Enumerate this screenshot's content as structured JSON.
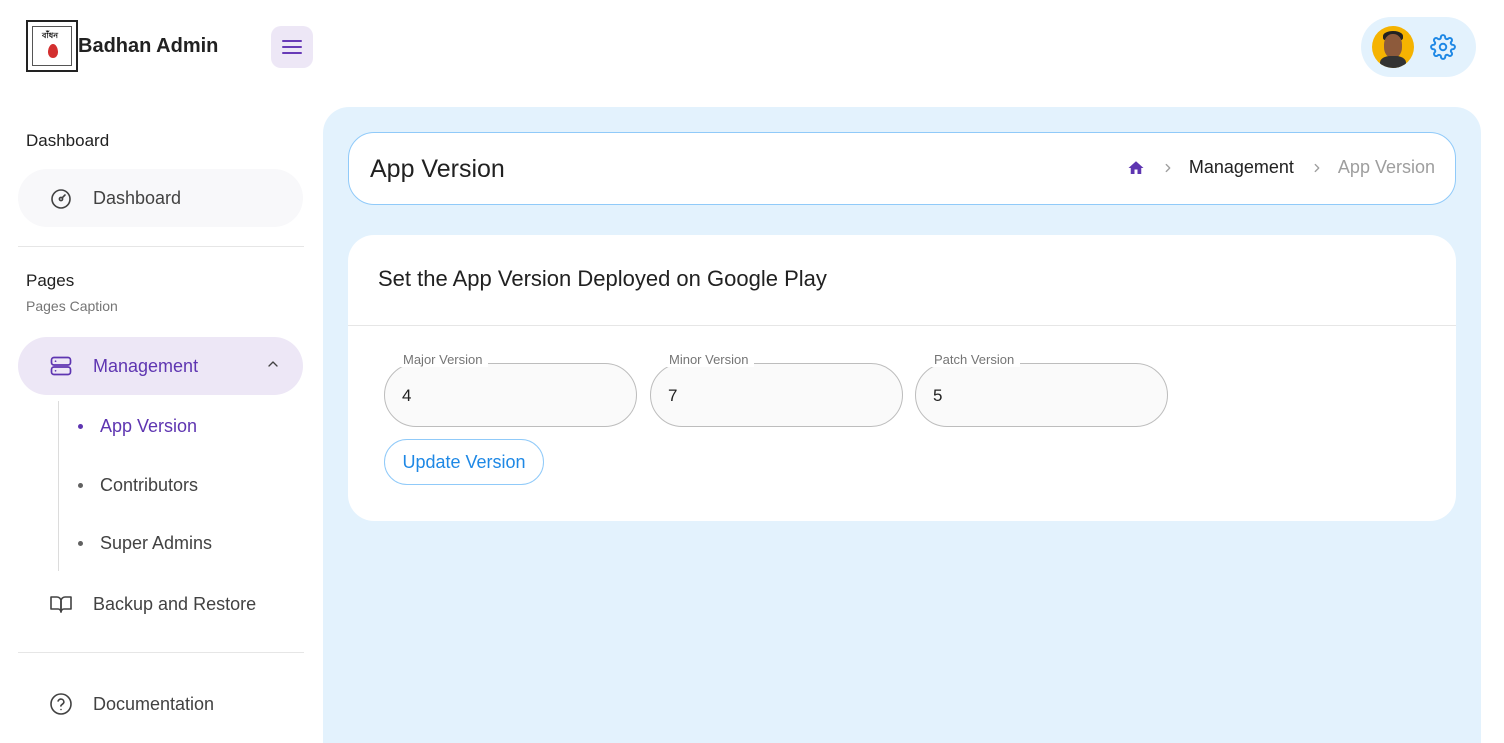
{
  "header": {
    "brand": "Badhan Admin",
    "logo_text": "বাঁধন",
    "menu_icon": "hamburger-icon",
    "settings_icon": "gear-icon",
    "accent_color": "#673ab7",
    "settings_color": "#1e88e5"
  },
  "sidebar": {
    "groups": [
      {
        "title": "Dashboard",
        "items": [
          {
            "label": "Dashboard",
            "icon": "gauge-icon"
          }
        ]
      },
      {
        "title": "Pages",
        "caption": "Pages Caption",
        "items": [
          {
            "label": "Management",
            "icon": "server-icon",
            "active": true,
            "expanded": true,
            "children": [
              {
                "label": "App Version",
                "active": true
              },
              {
                "label": "Contributors"
              },
              {
                "label": "Super Admins"
              }
            ]
          },
          {
            "label": "Backup and Restore",
            "icon": "book-icon"
          }
        ]
      },
      {
        "items": [
          {
            "label": "Documentation",
            "icon": "help-circle-icon"
          }
        ]
      }
    ]
  },
  "breadcrumb": {
    "title": "App Version",
    "home_icon": "home-icon",
    "items": [
      "Management",
      "App Version"
    ]
  },
  "form": {
    "title": "Set the App Version Deployed on Google Play",
    "fields": [
      {
        "label": "Major Version",
        "value": "4"
      },
      {
        "label": "Minor Version",
        "value": "7"
      },
      {
        "label": "Patch Version",
        "value": "5"
      }
    ],
    "submit_label": "Update Version"
  }
}
